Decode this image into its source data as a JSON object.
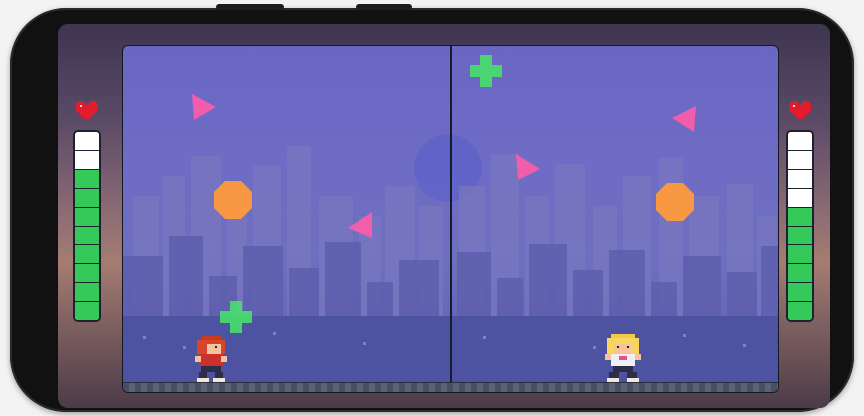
{
  "game": {
    "colors": {
      "enemy_triangle": "#ff5ca8",
      "enemy_octagon": "#ff9a3c",
      "heal_plus": "#47e06b",
      "health_fill": "#35c95a",
      "health_empty": "#ffffff",
      "heart": "#e21b2d"
    },
    "left_player": {
      "health_segments_total": 10,
      "health_segments_filled": 8,
      "health_fraction": 0.8,
      "heart_icon": "heart-icon",
      "character": "red-haired-runner"
    },
    "right_player": {
      "health_segments_total": 10,
      "health_segments_filled": 6,
      "health_fraction": 0.6,
      "heart_icon": "heart-icon",
      "character": "blonde-runner"
    }
  }
}
